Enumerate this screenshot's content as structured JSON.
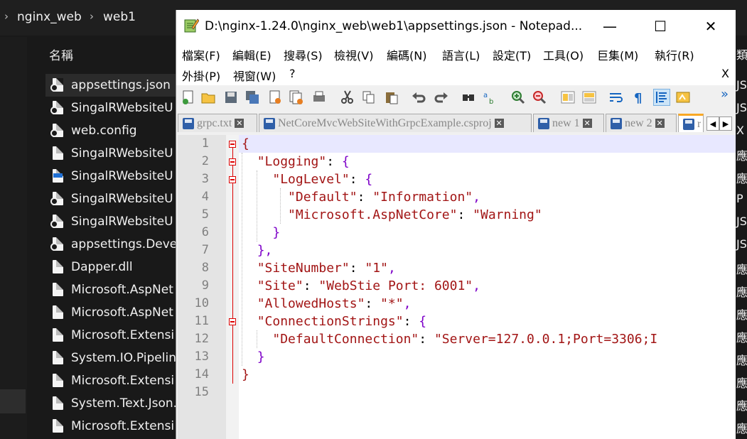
{
  "explorer": {
    "breadcrumb": [
      "nginx_web",
      "web1"
    ],
    "column_header": "名稱",
    "files": [
      {
        "name": "appsettings.json",
        "icon": "json-file-icon"
      },
      {
        "name": "SingalRWebsiteU",
        "icon": "json-file-icon"
      },
      {
        "name": "web.config",
        "icon": "config-file-icon"
      },
      {
        "name": "SingalRWebsiteU",
        "icon": "dll-file-icon"
      },
      {
        "name": "SingalRWebsiteU",
        "icon": "exe-file-icon"
      },
      {
        "name": "SingalRWebsiteU",
        "icon": "pdb-file-icon"
      },
      {
        "name": "SingalRWebsiteU",
        "icon": "json-file-icon"
      },
      {
        "name": "appsettings.Deve",
        "icon": "json-file-icon"
      },
      {
        "name": "Dapper.dll",
        "icon": "dll-file-icon"
      },
      {
        "name": "Microsoft.AspNet",
        "icon": "dll-file-icon"
      },
      {
        "name": "Microsoft.AspNet",
        "icon": "dll-file-icon"
      },
      {
        "name": "Microsoft.Extensi",
        "icon": "dll-file-icon"
      },
      {
        "name": "System.IO.Pipelin",
        "icon": "dll-file-icon"
      },
      {
        "name": "Microsoft.Extensi",
        "icon": "dll-file-icon"
      },
      {
        "name": "System.Text.Json.",
        "icon": "dll-file-icon"
      },
      {
        "name": "Microsoft.Extensi",
        "icon": "dll-file-icon"
      }
    ],
    "right_column_header": "類",
    "right_column": [
      "JS",
      "JS",
      "X",
      "應",
      "應",
      "P",
      "JS",
      "JS",
      "應",
      "應",
      "應",
      "應",
      "應",
      "應",
      "應",
      "應"
    ]
  },
  "notepad": {
    "title": "D:\\nginx-1.24.0\\nginx_web\\web1\\appsettings.json - Notepad...",
    "window_buttons": {
      "minimize": "—",
      "maximize": "☐",
      "close": "✕"
    },
    "menu_row1": [
      "檔案(F)",
      "編輯(E)",
      "搜尋(S)",
      "檢視(V)",
      "編碼(N)",
      "語言(L)",
      "設定(T)",
      "工具(O)",
      "巨集(M)",
      "執行(R)"
    ],
    "menu_row2": [
      "外掛(P)",
      "視窗(W)",
      "?"
    ],
    "menu_close": "X",
    "toolbar_more": "»",
    "tabs": [
      {
        "label": "grpc.txt",
        "active": false
      },
      {
        "label": "NetCoreMvcWebSiteWithGrpcExample.csproj",
        "active": false
      },
      {
        "label": "new 1",
        "active": false
      },
      {
        "label": "new 2",
        "active": false
      },
      {
        "label": "r",
        "active": true
      }
    ],
    "tab_scroll": {
      "left": "◀",
      "right": "▶"
    },
    "line_numbers": [
      "1",
      "2",
      "3",
      "4",
      "5",
      "6",
      "7",
      "8",
      "9",
      "10",
      "11",
      "12",
      "13",
      "14",
      "15"
    ],
    "code_lines": [
      [
        {
          "t": "{",
          "c": "s"
        }
      ],
      [
        {
          "t": "  ",
          "c": "p"
        },
        {
          "t": "\"Logging\"",
          "c": "s"
        },
        {
          "t": ": ",
          "c": "p"
        },
        {
          "t": "{",
          "c": "o"
        }
      ],
      [
        {
          "t": "    ",
          "c": "p"
        },
        {
          "t": "\"LogLevel\"",
          "c": "s"
        },
        {
          "t": ": ",
          "c": "p"
        },
        {
          "t": "{",
          "c": "o"
        }
      ],
      [
        {
          "t": "      ",
          "c": "p"
        },
        {
          "t": "\"Default\"",
          "c": "s"
        },
        {
          "t": ": ",
          "c": "p"
        },
        {
          "t": "\"Information\"",
          "c": "s"
        },
        {
          "t": ",",
          "c": "o"
        }
      ],
      [
        {
          "t": "      ",
          "c": "p"
        },
        {
          "t": "\"Microsoft.AspNetCore\"",
          "c": "s"
        },
        {
          "t": ": ",
          "c": "p"
        },
        {
          "t": "\"Warning\"",
          "c": "s"
        }
      ],
      [
        {
          "t": "    ",
          "c": "p"
        },
        {
          "t": "}",
          "c": "o"
        }
      ],
      [
        {
          "t": "  ",
          "c": "p"
        },
        {
          "t": "},",
          "c": "o"
        }
      ],
      [
        {
          "t": "  ",
          "c": "p"
        },
        {
          "t": "\"SiteNumber\"",
          "c": "s"
        },
        {
          "t": ": ",
          "c": "p"
        },
        {
          "t": "\"1\"",
          "c": "s"
        },
        {
          "t": ",",
          "c": "o"
        }
      ],
      [
        {
          "t": "  ",
          "c": "p"
        },
        {
          "t": "\"Site\"",
          "c": "s"
        },
        {
          "t": ": ",
          "c": "p"
        },
        {
          "t": "\"WebStie Port: 6001\"",
          "c": "s"
        },
        {
          "t": ",",
          "c": "o"
        }
      ],
      [
        {
          "t": "  ",
          "c": "p"
        },
        {
          "t": "\"AllowedHosts\"",
          "c": "s"
        },
        {
          "t": ": ",
          "c": "p"
        },
        {
          "t": "\"*\"",
          "c": "s"
        },
        {
          "t": ",",
          "c": "o"
        }
      ],
      [
        {
          "t": "  ",
          "c": "p"
        },
        {
          "t": "\"ConnectionStrings\"",
          "c": "s"
        },
        {
          "t": ": ",
          "c": "p"
        },
        {
          "t": "{",
          "c": "o"
        }
      ],
      [
        {
          "t": "    ",
          "c": "p"
        },
        {
          "t": "\"DefaultConnection\"",
          "c": "s"
        },
        {
          "t": ": ",
          "c": "p"
        },
        {
          "t": "\"Server=127.0.0.1;Port=3306;I",
          "c": "s"
        }
      ],
      [
        {
          "t": "  ",
          "c": "p"
        },
        {
          "t": "}",
          "c": "o"
        }
      ],
      [
        {
          "t": "}",
          "c": "s"
        }
      ],
      []
    ]
  }
}
